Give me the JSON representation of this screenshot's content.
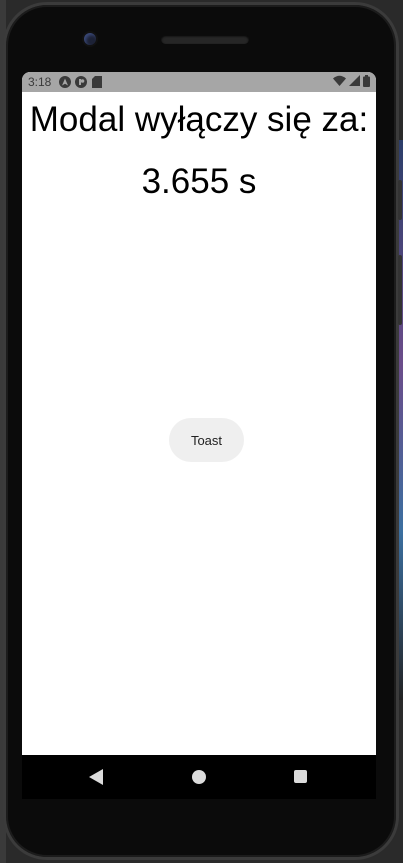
{
  "status_bar": {
    "time": "3:18",
    "left_icons": [
      "android-auto-icon",
      "vpn-key-icon",
      "sd-card-icon"
    ],
    "right_icons": [
      "wifi-icon",
      "cell-signal-icon",
      "battery-icon"
    ]
  },
  "main": {
    "title": "Modal wyłączy się za:",
    "countdown": "3.655 s",
    "toast_button_label": "Toast"
  },
  "nav_bar": {
    "buttons": [
      "back-icon",
      "home-icon",
      "recents-icon"
    ]
  },
  "colors": {
    "status_bar_bg": "#a6a6a6",
    "screen_bg": "#ffffff",
    "button_bg": "#efefef",
    "nav_bar_bg": "#000000"
  }
}
